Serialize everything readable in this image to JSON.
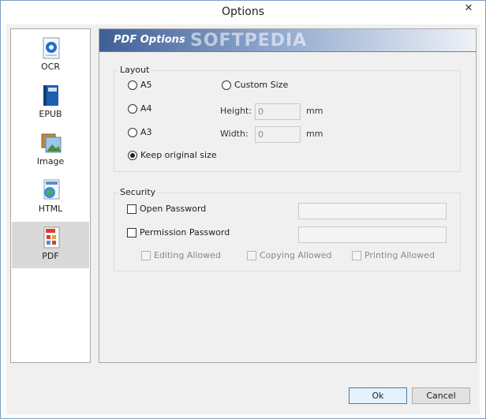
{
  "window": {
    "title": "Options",
    "close_glyph": "✕"
  },
  "sidebar": {
    "items": [
      {
        "label": "OCR",
        "icon": "ocr-icon"
      },
      {
        "label": "EPUB",
        "icon": "epub-icon"
      },
      {
        "label": "Image",
        "icon": "image-icon"
      },
      {
        "label": "HTML",
        "icon": "html-icon"
      },
      {
        "label": "PDF",
        "icon": "pdf-icon",
        "selected": true
      }
    ]
  },
  "panel": {
    "title": "PDF Options",
    "watermark": "SOFTPEDIA",
    "layout": {
      "title": "Layout",
      "sizes": [
        {
          "label": "A5",
          "selected": false
        },
        {
          "label": "A4",
          "selected": false
        },
        {
          "label": "A3",
          "selected": false
        },
        {
          "label": "Keep original size",
          "selected": true
        }
      ],
      "custom_size": {
        "label": "Custom Size",
        "selected": false
      },
      "height": {
        "label": "Height:",
        "value": "0",
        "unit": "mm"
      },
      "width": {
        "label": "Width:",
        "value": "0",
        "unit": "mm"
      }
    },
    "security": {
      "title": "Security",
      "open_password": {
        "label": "Open Password",
        "checked": false,
        "value": ""
      },
      "permission_password": {
        "label": "Permission Password",
        "checked": false,
        "value": ""
      },
      "permissions": [
        {
          "label": "Editing Allowed",
          "checked": false
        },
        {
          "label": "Copying Allowed",
          "checked": false
        },
        {
          "label": "Printing Allowed",
          "checked": false
        }
      ]
    }
  },
  "buttons": {
    "ok": "Ok",
    "cancel": "Cancel"
  },
  "colors": {
    "banner_start": "#3f5f95",
    "selected_bg": "#d9d9d9",
    "default_button_border": "#3c7fb1"
  }
}
